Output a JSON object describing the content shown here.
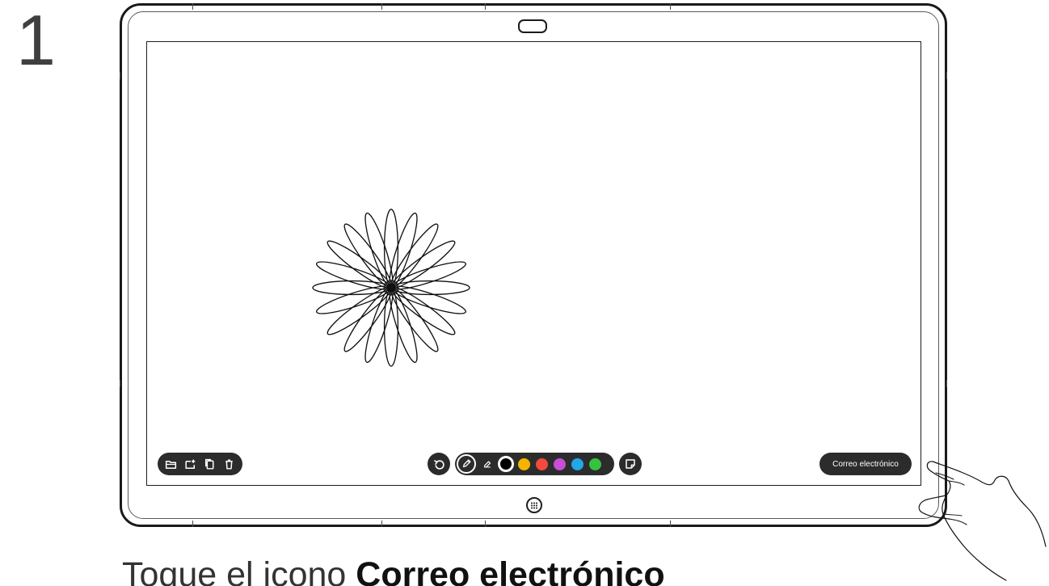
{
  "step": {
    "number": "1"
  },
  "device": {
    "camera_icon": "camera-icon",
    "home_icon": "keypad-home-icon"
  },
  "whiteboard": {
    "drawing": "flower-drawing",
    "file_tools": [
      {
        "icon": "folder-icon"
      },
      {
        "icon": "add-page-icon"
      },
      {
        "icon": "copy-icon"
      },
      {
        "icon": "trash-icon"
      }
    ],
    "undo_icon": "undo-icon",
    "pen_icon": "pen-icon",
    "eraser_icon": "eraser-icon",
    "colors": {
      "black": "#000000",
      "yellow": "#f4b400",
      "red": "#f24b3d",
      "magenta": "#c84ed6",
      "blue": "#22a7e8",
      "green": "#35c33d"
    },
    "note_icon": "sticky-note-icon",
    "email_button": "Correo electrónico"
  },
  "instruction": {
    "prefix": "Toque el icono ",
    "bold_text": "Correo electrónico"
  },
  "hand_icon": "pointing-hand-icon"
}
